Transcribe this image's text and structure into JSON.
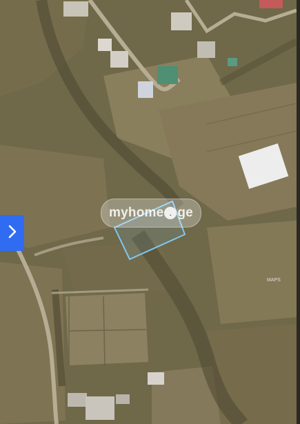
{
  "map": {
    "watermark_prefix": "myhome",
    "watermark_suffix": "ge",
    "corner_label": "MAPS"
  },
  "controls": {
    "next_icon": "chevron-right-icon",
    "next_color": "#2f6cf2"
  },
  "colors": {
    "parcel_outline": "#7fc8f0",
    "field": "#8a7f5c",
    "road": "#b7ad94"
  }
}
